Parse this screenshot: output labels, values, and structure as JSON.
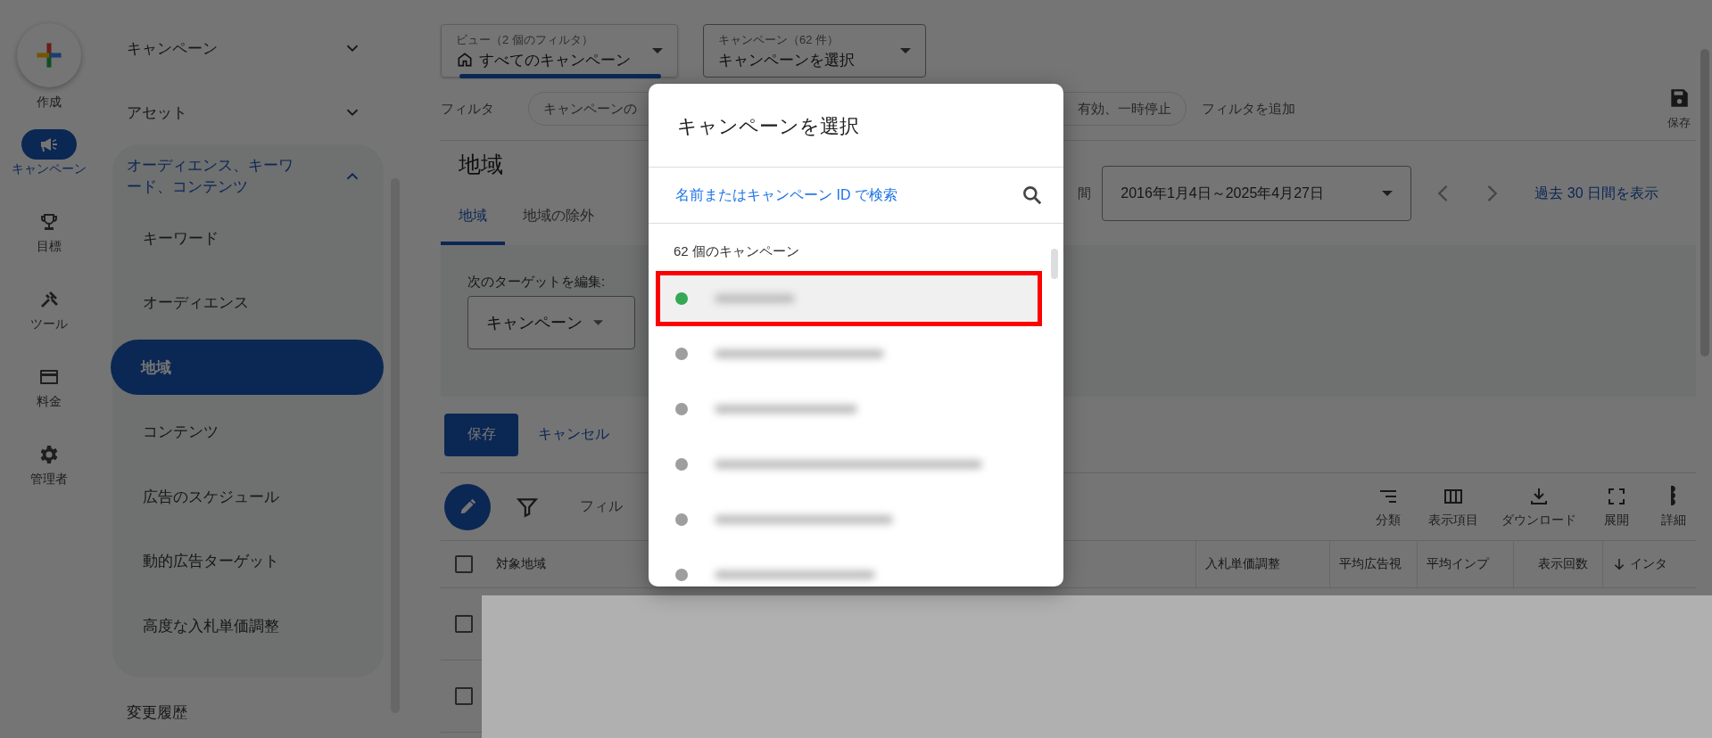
{
  "rail": {
    "create_label": "作成",
    "items": [
      {
        "label": "キャンペーン",
        "kind": "megaphone",
        "selected": true
      },
      {
        "label": "目標",
        "kind": "trophy",
        "selected": false
      },
      {
        "label": "ツール",
        "kind": "tools",
        "selected": false
      },
      {
        "label": "料金",
        "kind": "card",
        "selected": false
      },
      {
        "label": "管理者",
        "kind": "gear",
        "selected": false
      }
    ]
  },
  "nav": {
    "items": [
      {
        "label": "キャンペーン",
        "kind": "group",
        "expanded": false
      },
      {
        "label": "アセット",
        "kind": "group",
        "expanded": false
      },
      {
        "label": "オーディエンス、キーワード、コンテンツ",
        "kind": "group",
        "expanded": true,
        "children": [
          {
            "label": "キーワード",
            "selected": false
          },
          {
            "label": "オーディエンス",
            "selected": false
          },
          {
            "label": "地域",
            "selected": true
          },
          {
            "label": "コンテンツ",
            "selected": false
          },
          {
            "label": "広告のスケジュール",
            "selected": false
          },
          {
            "label": "動的広告ターゲット",
            "selected": false
          },
          {
            "label": "高度な入札単価調整",
            "selected": false
          }
        ]
      },
      {
        "label": "変更履歴",
        "kind": "link"
      }
    ]
  },
  "view_selector": {
    "label": "ビュー（2 個のフィルタ）",
    "value": "すべてのキャンペーン"
  },
  "campaign_selector": {
    "label": "キャンペーン（62 件）",
    "value": "キャンペーンを選択"
  },
  "filter_bar": {
    "label": "フィルタ",
    "chip_start": "キャンペーンの",
    "chip_end": "有効、一時停止",
    "add": "フィルタを追加"
  },
  "save_view": "保存",
  "heading": "地域",
  "date_range": {
    "label": "間",
    "value": "2016年1月4日～2025年4月27日",
    "show_last": "過去 30 日間を表示"
  },
  "tabs": [
    {
      "label": "地域",
      "selected": true
    },
    {
      "label": "地域の除外",
      "selected": false
    }
  ],
  "edit_panel": {
    "label": "次のターゲットを編集:",
    "value": "キャンペーン"
  },
  "actions": {
    "save": "保存",
    "cancel": "キャンセル"
  },
  "table_toolbar": {
    "filter_text": "フィル",
    "tools": [
      {
        "label": "分類",
        "kind": "segment"
      },
      {
        "label": "表示項目",
        "kind": "columns"
      },
      {
        "label": "ダウンロード",
        "kind": "download"
      },
      {
        "label": "展開",
        "kind": "expand"
      },
      {
        "label": "詳細",
        "kind": "more"
      }
    ]
  },
  "table": {
    "columns": [
      {
        "label": "対象地域",
        "sorted": false
      },
      {
        "label": "入札単価調整",
        "sorted": false
      },
      {
        "label": "平均広告視",
        "sorted": false
      },
      {
        "label": "平均インプ",
        "sorted": false
      },
      {
        "label": "表示回数",
        "sorted": false
      },
      {
        "label": "インタ",
        "sorted": true
      }
    ],
    "select_all_checked": false,
    "rows": [
      {
        "checked": false
      },
      {
        "checked": false
      }
    ]
  },
  "modal": {
    "title": "キャンペーンを選択",
    "search_placeholder": "名前またはキャンペーン ID で検索",
    "count": "62 個のキャンペーン",
    "campaigns": [
      {
        "highlighted": true,
        "color": "#34a853"
      },
      {
        "highlighted": false,
        "color": "#9e9e9e"
      },
      {
        "highlighted": false,
        "color": "#9e9e9e"
      },
      {
        "highlighted": false,
        "color": "#9e9e9e"
      },
      {
        "highlighted": false,
        "color": "#9e9e9e"
      },
      {
        "highlighted": false,
        "color": "#9e9e9e"
      }
    ]
  }
}
